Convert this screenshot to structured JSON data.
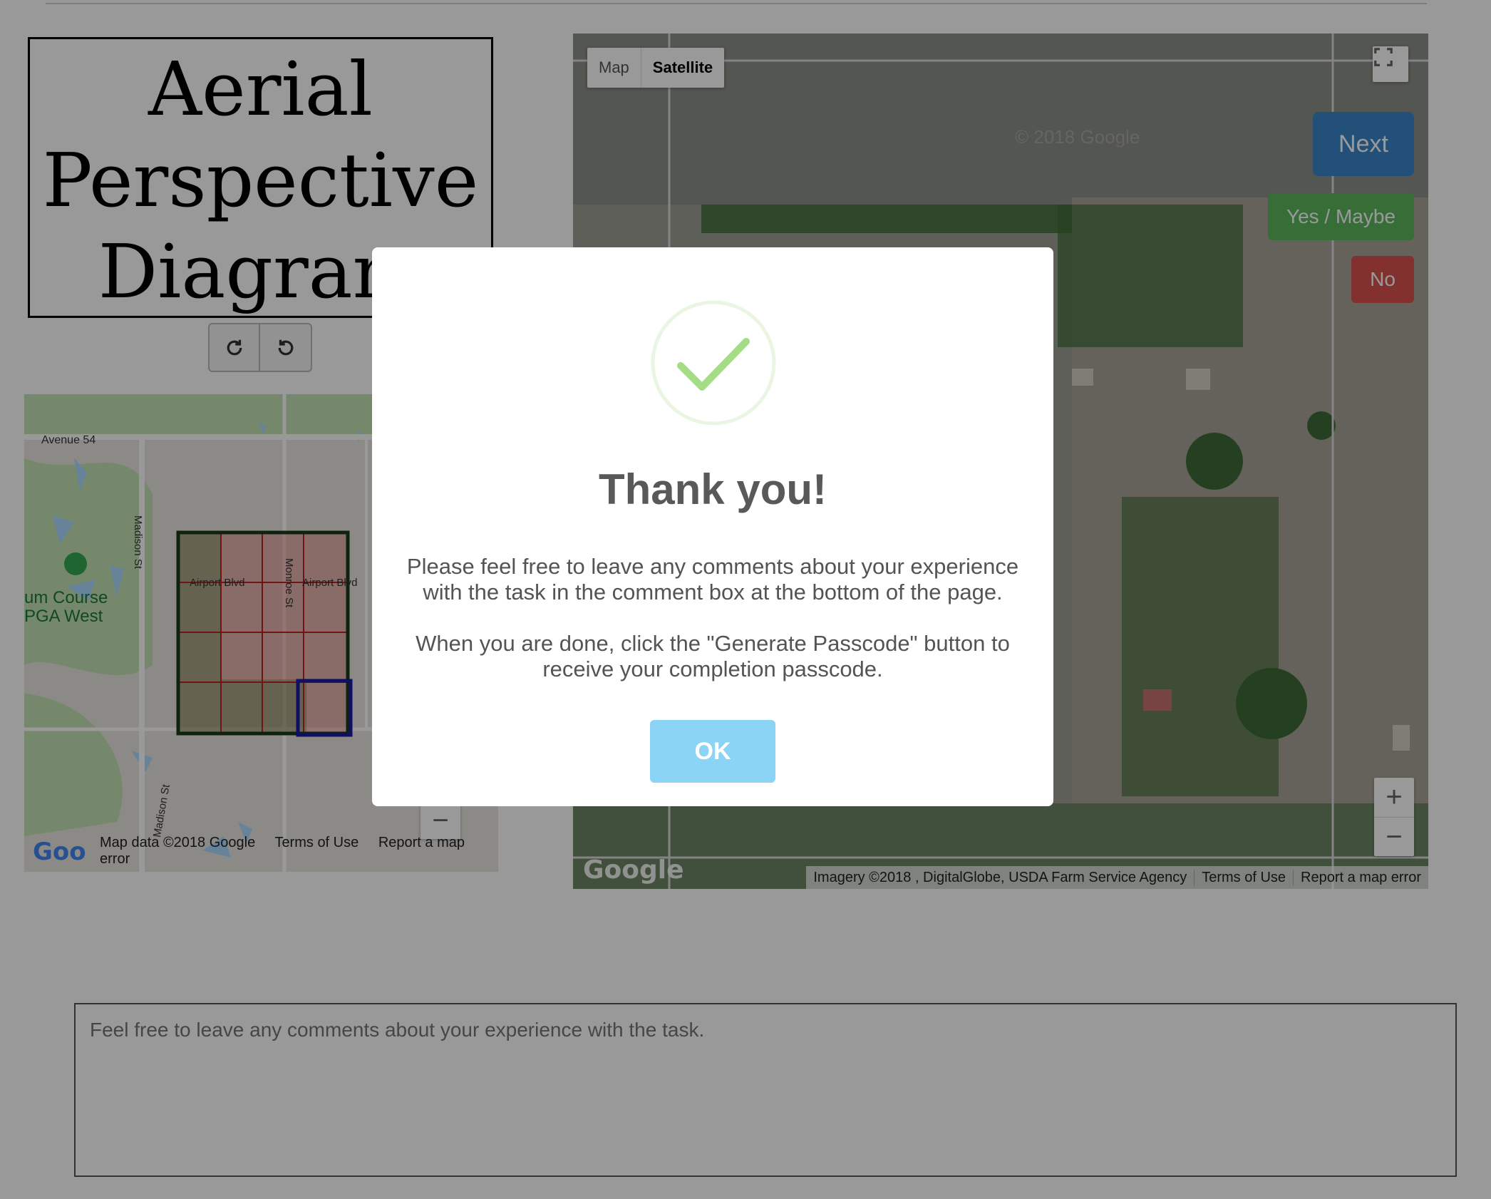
{
  "diagram": {
    "lines": [
      "Aerial",
      "Perspective",
      "Diagram"
    ]
  },
  "small_map": {
    "labels": {
      "avenue": "Avenue 54",
      "madison_st_1": "Madison St",
      "madison_st_2": "Madison St",
      "monroe_st": "Monroe St",
      "airport_blvd_1": "Airport Blvd",
      "airport_blvd_2": "Airport Blvd",
      "course_line1": "um Course",
      "course_line2": "PGA West"
    },
    "attribution": [
      "Map data ©2018 Google",
      "Terms of Use",
      "Report a map error"
    ],
    "zoom_out": "−"
  },
  "satellite": {
    "map_types": [
      "Map",
      "Satellite"
    ],
    "selected": "Satellite",
    "buttons": {
      "next": "Next",
      "yes": "Yes / Maybe",
      "no": "No"
    },
    "zoom_in": "+",
    "zoom_out": "−",
    "watermark": "© 2018 Google",
    "attribution": [
      "Imagery ©2018 , DigitalGlobe, USDA Farm Service Agency",
      "Terms of Use",
      "Report a map error"
    ]
  },
  "comment": {
    "placeholder": "Feel free to leave any comments about your experience with the task."
  },
  "modal": {
    "title": "Thank you!",
    "text1": "Please feel free to leave any comments about your experience with the task in the comment box at the bottom of the page.",
    "text2": "When you are done, click the \"Generate Passcode\" button to receive your completion passcode.",
    "ok": "OK"
  },
  "colors": {
    "next": "#3a86c8",
    "yes": "#5cb85c",
    "no": "#d9534f",
    "ok": "#8cd4f5",
    "check": "#a5dc86"
  }
}
